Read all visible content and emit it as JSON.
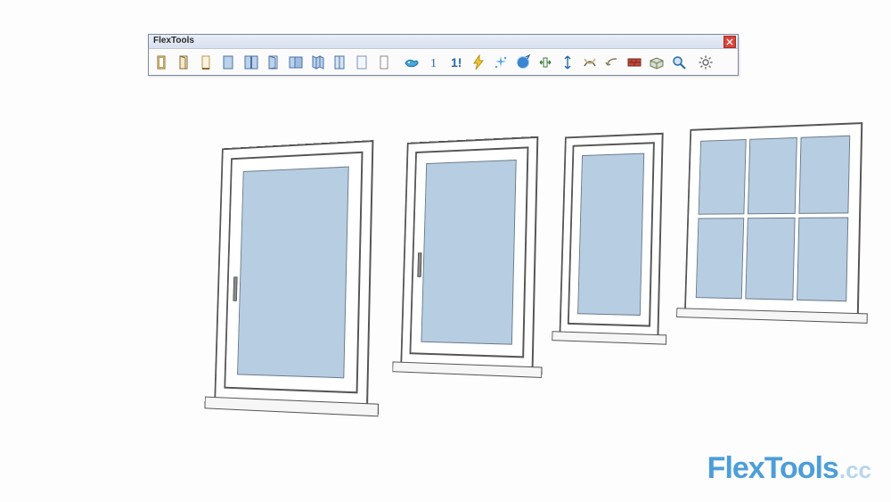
{
  "toolbar": {
    "title": "FlexTools",
    "icons": [
      "door-single",
      "door-open",
      "door-frame",
      "window-single",
      "window-double",
      "window-open",
      "window-sliding",
      "window-bifold",
      "window-panel",
      "window-blank",
      "window-basic",
      "whale",
      "numeral-1",
      "numeral-1-bold",
      "bolt",
      "sparkles",
      "compass-sphere",
      "arrows-horizontal",
      "arrows-vertical",
      "curve-swap",
      "arrow-back",
      "bricks-red",
      "bricks-perspective",
      "magnifier",
      "gear"
    ]
  },
  "watermark": {
    "brand": "FlexTools",
    "suffix": ".cc"
  },
  "scene": {
    "windows": [
      {
        "id": "window-1",
        "type": "casement",
        "handle": true
      },
      {
        "id": "window-2",
        "type": "casement",
        "handle": true
      },
      {
        "id": "window-3",
        "type": "casement-narrow",
        "handle": false
      },
      {
        "id": "window-4",
        "type": "grid-6pane",
        "handle": false
      }
    ]
  }
}
